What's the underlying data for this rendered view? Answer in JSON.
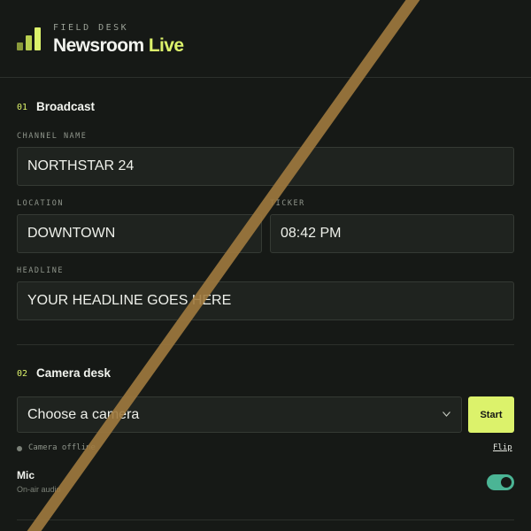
{
  "header": {
    "eyebrow": "FIELD DESK",
    "brand_main": "Newsroom",
    "brand_accent": "Live",
    "logo_icon": "bars-icon"
  },
  "broadcast": {
    "number": "01",
    "title": "Broadcast",
    "channel_label": "CHANNEL NAME",
    "channel_value": "NORTHSTAR 24",
    "location_label": "LOCATION",
    "location_value": "DOWNTOWN",
    "ticker_label": "TICKER",
    "ticker_value": "08:42 PM",
    "headline_label": "HEADLINE",
    "headline_value": "YOUR HEADLINE GOES HERE"
  },
  "camera": {
    "number": "02",
    "title": "Camera desk",
    "select_value": "Choose a camera",
    "start_label": "Start",
    "status_text": "Camera offline",
    "flip_label": "Flip",
    "mic_title": "Mic",
    "mic_sub": "On-air audio",
    "mic_on": true
  },
  "colors": {
    "accent": "#dcf26b",
    "background": "#161916",
    "toggle_on": "#4bb595",
    "overlay_stroke": "#a07a3e"
  }
}
